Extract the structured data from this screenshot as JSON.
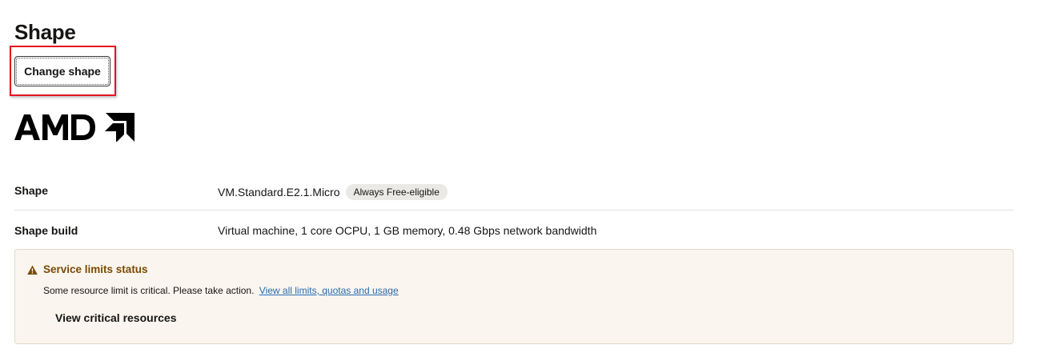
{
  "section": {
    "title": "Shape",
    "change_button_label": "Change shape",
    "vendor_logo_text": "AMD"
  },
  "details": [
    {
      "label": "Shape",
      "value": "VM.Standard.E2.1.Micro",
      "badge": "Always Free-eligible"
    },
    {
      "label": "Shape build",
      "value": "Virtual machine, 1 core OCPU, 1 GB memory, 0.48 Gbps network bandwidth"
    }
  ],
  "alert": {
    "title": "Service limits status",
    "message": "Some resource limit is critical. Please take action.",
    "link_text": "View all limits, quotas and usage",
    "action_label": "View critical resources",
    "icon": "warning-triangle-icon"
  },
  "colors": {
    "highlight": "#e5131f",
    "alert_background": "#faf5ee",
    "alert_title": "#7a4a04",
    "link": "#2b6cb0",
    "badge_background": "#ebe9e6"
  }
}
